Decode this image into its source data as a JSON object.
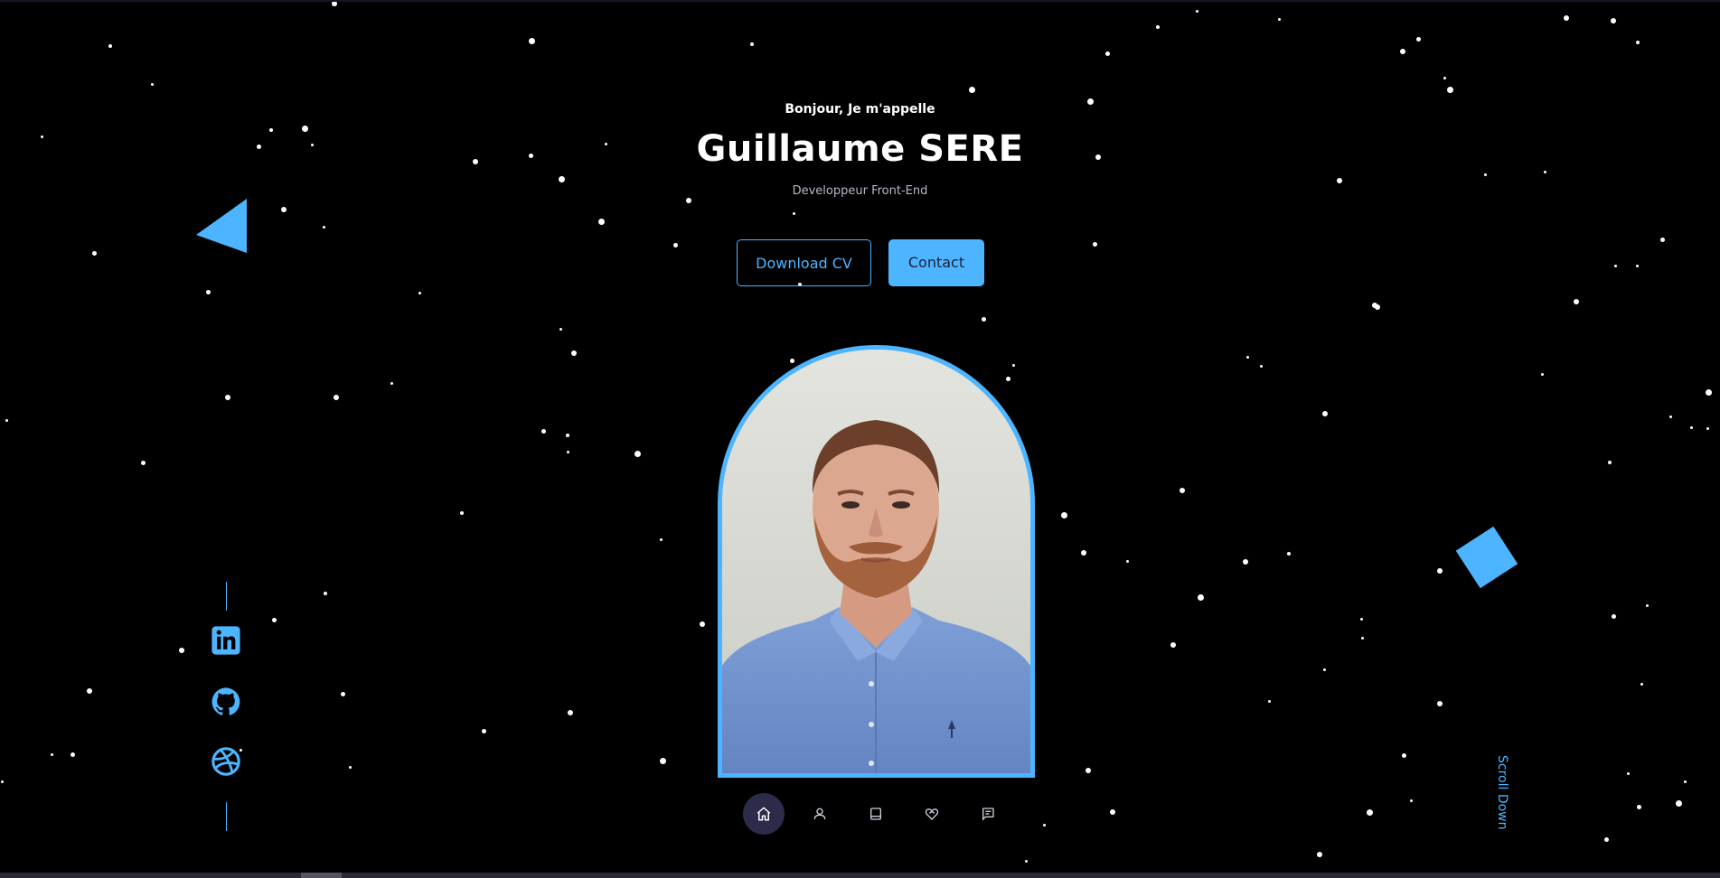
{
  "hero": {
    "greeting": "Bonjour, Je m'appelle",
    "name": "Guillaume SERE",
    "role": "Developpeur Front-End",
    "download_cv_label": "Download CV",
    "contact_label": "Contact",
    "photo_alt": "Guillaume SERE"
  },
  "social": [
    "linkedin-icon",
    "github-icon",
    "dribbble-icon"
  ],
  "nav": [
    "home-icon",
    "user-icon",
    "book-icon",
    "services-icon",
    "message-icon"
  ],
  "nav_active": "home-icon",
  "scroll_down": "Scroll Down",
  "colors": {
    "accent": "#4db5ff",
    "background": "#000000",
    "nav_active": "#2c2c4a"
  }
}
